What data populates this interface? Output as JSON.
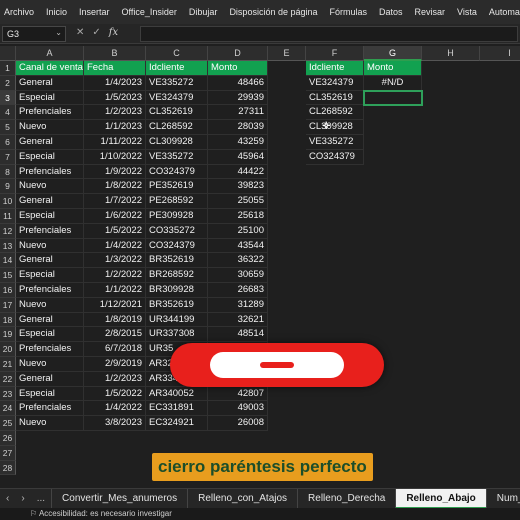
{
  "menu": [
    "Archivo",
    "Inicio",
    "Insertar",
    "Office_Insider",
    "Dibujar",
    "Disposición de página",
    "Fórmulas",
    "Datos",
    "Revisar",
    "Vista",
    "Automatizar"
  ],
  "formula_bar": {
    "name_box": "G3",
    "cancel_icon": "✕",
    "enter_icon": "✓",
    "fx_label": "fx",
    "formula": ""
  },
  "columns": [
    "A",
    "B",
    "C",
    "D",
    "E",
    "F",
    "G",
    "H",
    "I"
  ],
  "rows": [
    "1",
    "2",
    "3",
    "4",
    "5",
    "6",
    "7",
    "8",
    "9",
    "10",
    "11",
    "12",
    "13",
    "14",
    "15",
    "16",
    "17",
    "18",
    "19",
    "20",
    "21",
    "22",
    "23",
    "24",
    "25",
    "26",
    "27",
    "28"
  ],
  "table": {
    "headers": [
      "Canal de venta",
      "Fecha",
      "Idcliente",
      "Monto"
    ],
    "rows": [
      [
        "General",
        "1/4/2023",
        "VE335272",
        "48466"
      ],
      [
        "Especial",
        "1/5/2023",
        "VE324379",
        "29939"
      ],
      [
        "Prefenciales",
        "1/2/2023",
        "CL352619",
        "27311"
      ],
      [
        "Nuevo",
        "1/1/2023",
        "CL268592",
        "28039"
      ],
      [
        "General",
        "1/11/2022",
        "CL309928",
        "43259"
      ],
      [
        "Especial",
        "1/10/2022",
        "VE335272",
        "45964"
      ],
      [
        "Prefenciales",
        "1/9/2022",
        "CO324379",
        "44422"
      ],
      [
        "Nuevo",
        "1/8/2022",
        "PE352619",
        "39823"
      ],
      [
        "General",
        "1/7/2022",
        "PE268592",
        "25055"
      ],
      [
        "Especial",
        "1/6/2022",
        "PE309928",
        "25618"
      ],
      [
        "Prefenciales",
        "1/5/2022",
        "CO335272",
        "25100"
      ],
      [
        "Nuevo",
        "1/4/2022",
        "CO324379",
        "43544"
      ],
      [
        "General",
        "1/3/2022",
        "BR352619",
        "36322"
      ],
      [
        "Especial",
        "1/2/2022",
        "BR268592",
        "30659"
      ],
      [
        "Prefenciales",
        "1/1/2022",
        "BR309928",
        "26683"
      ],
      [
        "Nuevo",
        "1/12/2021",
        "BR352619",
        "31289"
      ],
      [
        "General",
        "1/8/2019",
        "UR344199",
        "32621"
      ],
      [
        "Especial",
        "2/8/2015",
        "UR337308",
        "48514"
      ],
      [
        "Prefenciales",
        "6/7/2018",
        "UR35",
        ""
      ],
      [
        "Nuevo",
        "2/9/2019",
        "AR32",
        ""
      ],
      [
        "General",
        "1/2/2023",
        "AR334",
        ""
      ],
      [
        "Especial",
        "1/5/2022",
        "AR340052",
        "42807"
      ],
      [
        "Prefenciales",
        "1/4/2022",
        "EC331891",
        "49003"
      ],
      [
        "Nuevo",
        "3/8/2023",
        "EC324921",
        "26008"
      ]
    ]
  },
  "lookup": {
    "headers": [
      "Idcliente",
      "Monto"
    ],
    "ids": [
      "VE324379",
      "CL352619",
      "CL268592",
      "CL309928",
      "VE335272",
      "CO324379"
    ],
    "results": [
      "#N/D"
    ]
  },
  "sheet_tabs": [
    "Convertir_Mes_anumeros",
    "Relleno_con_Atajos",
    "Relleno_Derecha",
    "Relleno_Abajo",
    "Num_Aleatorios"
  ],
  "active_tab": "Relleno_Abajo",
  "sheet_nav": {
    "prev": "‹",
    "next": "›",
    "more": "..."
  },
  "status": "Accesibilidad: es necesario investigar",
  "caption": "cierro paréntesis perfecto",
  "colors": {
    "header_green": "#12a150",
    "overlay_red": "#e8201c",
    "caption_bg": "#e89d1e",
    "caption_text": "#1c4e2a",
    "selection": "#2ea05a"
  }
}
